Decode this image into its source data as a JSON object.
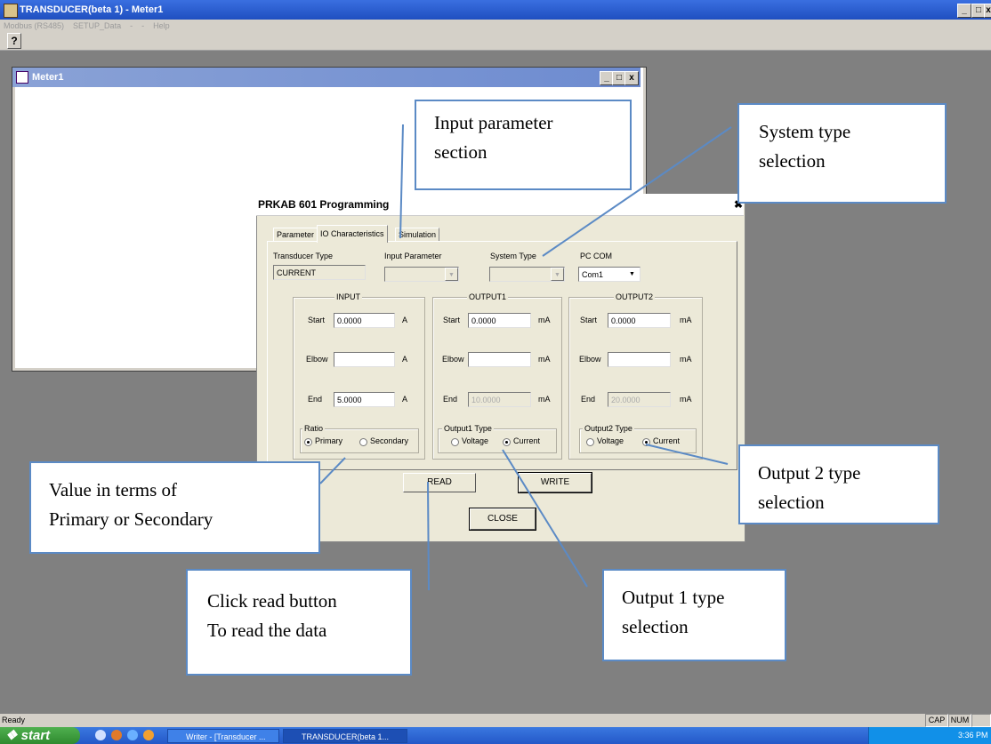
{
  "app": {
    "title": "TRANSDUCER(beta 1) - Meter1",
    "menu": [
      "Modbus (RS485)",
      "SETUP_Data",
      "-",
      "-",
      "Help"
    ],
    "help_icon": "help-icon"
  },
  "meter_window": {
    "title": "Meter1"
  },
  "dialog": {
    "title": "PRKAB 601 Programming",
    "tabs": [
      "Parameter",
      "IO Characteristics",
      "Simulation"
    ],
    "active_tab": "IO Characteristics",
    "transducer_type_label": "Transducer Type",
    "transducer_type_value": "CURRENT",
    "input_parameter_label": "Input Parameter",
    "system_type_label": "System Type",
    "pc_com_label": "PC COM",
    "pc_com_value": "Com1",
    "input": {
      "title": "INPUT",
      "start_label": "Start",
      "start_value": "0.0000",
      "elbow_label": "Elbow",
      "elbow_value": "",
      "end_label": "End",
      "end_value": "5.0000",
      "unit": "A",
      "ratio_title": "Ratio",
      "ratio_primary": "Primary",
      "ratio_secondary": "Secondary",
      "ratio_selected": "Primary"
    },
    "output1": {
      "title": "OUTPUT1",
      "start_label": "Start",
      "start_value": "0.0000",
      "elbow_label": "Elbow",
      "elbow_value": "",
      "end_label": "End",
      "end_value": "10.0000",
      "unit": "mA",
      "type_title": "Output1 Type",
      "voltage": "Voltage",
      "current": "Current",
      "selected": "Current"
    },
    "output2": {
      "title": "OUTPUT2",
      "start_label": "Start",
      "start_value": "0.0000",
      "elbow_label": "Elbow",
      "elbow_value": "",
      "end_label": "End",
      "end_value": "20.0000",
      "unit": "mA",
      "type_title": "Output2 Type",
      "voltage": "Voltage",
      "current": "Current",
      "selected": "Current"
    },
    "read_button": "READ",
    "write_button": "WRITE",
    "close_button": "CLOSE"
  },
  "annotations": {
    "input_parameter": [
      "Input parameter",
      "section"
    ],
    "system_type": [
      "System type",
      "selection"
    ],
    "value_terms": [
      "Value in terms of",
      "Primary or Secondary"
    ],
    "output2_type": [
      "Output 2 type",
      "selection"
    ],
    "read_button": [
      "Click read button",
      "To read the data"
    ],
    "output1_type": [
      "Output 1 type",
      "selection"
    ]
  },
  "status": {
    "text": "Ready",
    "cap": "CAP",
    "num": "NUM"
  },
  "taskbar": {
    "start": "start",
    "buttons": [
      "Writer - [Transducer ...",
      "TRANSDUCER(beta 1..."
    ],
    "clock": "3:36 PM"
  },
  "colors": {
    "annotation_border": "#5b8ac5",
    "titlebar": "#2a56c9",
    "desktop": "#808080"
  }
}
